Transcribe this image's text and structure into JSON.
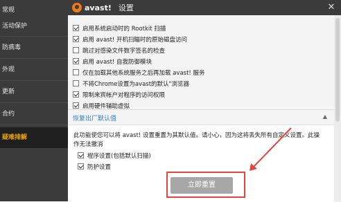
{
  "window": {
    "brand": "avast!",
    "title": "设置",
    "close_glyph": "✕"
  },
  "sidebar": {
    "items": [
      {
        "label": "常规"
      },
      {
        "label": "活动保护"
      },
      {
        "label": "防病毒"
      },
      {
        "label": "外观"
      },
      {
        "label": "更新"
      },
      {
        "label": "合约"
      },
      {
        "label": "工具"
      },
      {
        "label": "疑难排解",
        "active": true
      }
    ]
  },
  "options": [
    {
      "label": "启用系统启动时的 Rootkit 扫描",
      "checked": true
    },
    {
      "label": "启用 avast! 开机扫瞄时的原始磁盘访问",
      "checked": true
    },
    {
      "label": "跳过对感染文件数字签名的检查",
      "checked": false
    },
    {
      "label": "启用 avast! 自我防御模块",
      "checked": true
    },
    {
      "label": "仅在加载其他系统服务之后再加载 avast! 服务",
      "checked": false
    },
    {
      "label": "不将Chrome设置为avast的默认\"浏览器",
      "checked": false
    },
    {
      "label": "限制来宾帐户对程序的访问权限",
      "checked": true
    },
    {
      "label": "启用硬件辅助虚拟",
      "checked": true
    }
  ],
  "reset_section": {
    "title": "恢复出厂默认值",
    "collapse_glyph": "▲",
    "description": "此功能使您可以将 avast! 设置重置为其默认值。请小心，因为这将丢失所有自定义设置。此操作无法撤消",
    "items": [
      {
        "label": "程序设置(包括默认扫描)",
        "checked": true
      },
      {
        "label": "防护设置",
        "checked": true
      }
    ],
    "button_label": "立即重置"
  },
  "colors": {
    "sidebar_bg": "#3b3b3b",
    "accent": "#f0a500",
    "link_blue": "#2f7fc8",
    "annotation_red": "#e5443a"
  }
}
